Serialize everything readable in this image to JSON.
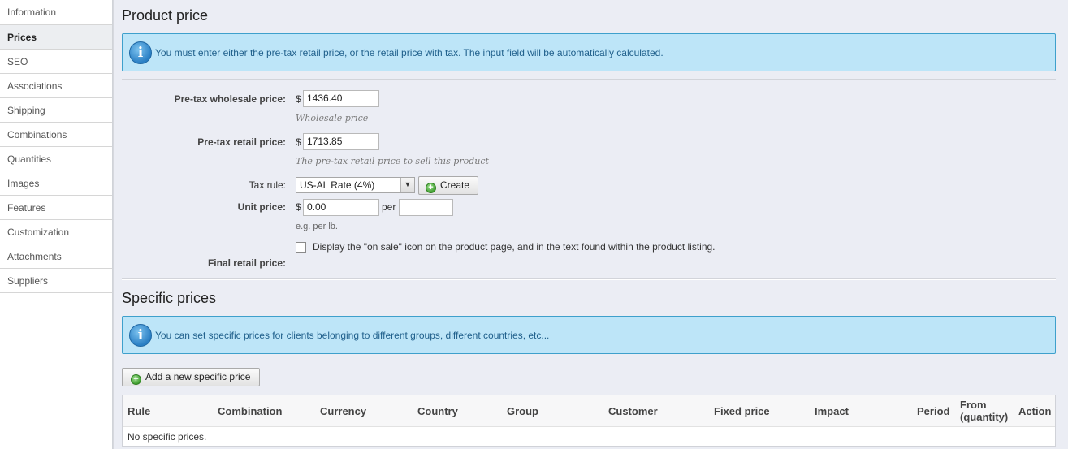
{
  "sidebar": {
    "items": [
      {
        "label": "Information"
      },
      {
        "label": "Prices"
      },
      {
        "label": "SEO"
      },
      {
        "label": "Associations"
      },
      {
        "label": "Shipping"
      },
      {
        "label": "Combinations"
      },
      {
        "label": "Quantities"
      },
      {
        "label": "Images"
      },
      {
        "label": "Features"
      },
      {
        "label": "Customization"
      },
      {
        "label": "Attachments"
      },
      {
        "label": "Suppliers"
      }
    ],
    "active": "Prices"
  },
  "product_price": {
    "title": "Product price",
    "info": "You must enter either the pre-tax retail price, or the retail price with tax. The input field will be automatically calculated.",
    "wholesale": {
      "label": "Pre-tax wholesale price:",
      "currency": "$",
      "value": "1436.40",
      "hint": "Wholesale price"
    },
    "retail": {
      "label": "Pre-tax retail price:",
      "currency": "$",
      "value": "1713.85",
      "hint": "The pre-tax retail price to sell this product"
    },
    "tax": {
      "label": "Tax rule:",
      "selected": "US-AL Rate (4%)",
      "create_label": "Create"
    },
    "unit": {
      "label": "Unit price:",
      "currency": "$",
      "value": "0.00",
      "per_label": "per",
      "per_value": "",
      "hint": "e.g. per lb."
    },
    "on_sale": {
      "label": "Display the \"on sale\" icon on the product page, and in the text found within the product listing.",
      "checked": false
    },
    "final": {
      "label": "Final retail price:",
      "value": ""
    }
  },
  "specific_prices": {
    "title": "Specific prices",
    "info": "You can set specific prices for clients belonging to different groups, different countries, etc...",
    "add_label": "Add a new specific price",
    "columns": [
      "Rule",
      "Combination",
      "Currency",
      "Country",
      "Group",
      "Customer",
      "Fixed price",
      "Impact",
      "Period",
      "From (quantity)",
      "Action"
    ],
    "from_line1": "From",
    "from_line2": "(quantity)",
    "empty_text": "No specific prices."
  },
  "colors": {
    "info_bg": "#bde5f8",
    "info_border": "#3ea0cc",
    "main_bg": "#ebedf4"
  }
}
